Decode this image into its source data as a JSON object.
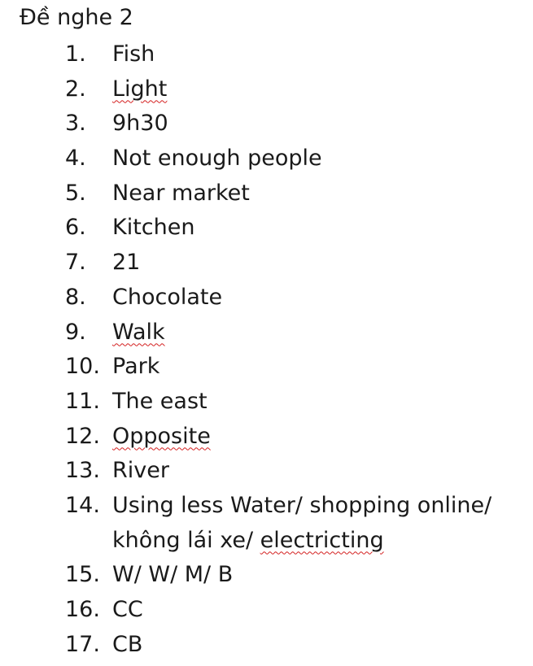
{
  "title": "Đề nghe 2",
  "answers": [
    {
      "num": "1.",
      "text": "Fish"
    },
    {
      "num": "2.",
      "text": "Light"
    },
    {
      "num": "3.",
      "text": "9h30"
    },
    {
      "num": "4.",
      "text": "Not enough people"
    },
    {
      "num": "5.",
      "text": "Near market"
    },
    {
      "num": "6.",
      "text": "Kitchen"
    },
    {
      "num": "7.",
      "text": "21"
    },
    {
      "num": "8.",
      "text": "Chocolate"
    },
    {
      "num": "9.",
      "text": "Walk"
    },
    {
      "num": "10.",
      "text": "Park"
    },
    {
      "num": "11.",
      "text": "The east"
    },
    {
      "num": "12.",
      "text": "Opposite"
    },
    {
      "num": "13.",
      "text": "River"
    },
    {
      "num": "14.",
      "line1": "Using less Water/ shopping online/",
      "line2_a": "không lái xe/ ",
      "line2_b": "electricting"
    },
    {
      "num": "15.",
      "text": "W/ W/ M/ B"
    },
    {
      "num": "16.",
      "text": "CC"
    },
    {
      "num": "17.",
      "text": "CB"
    }
  ]
}
